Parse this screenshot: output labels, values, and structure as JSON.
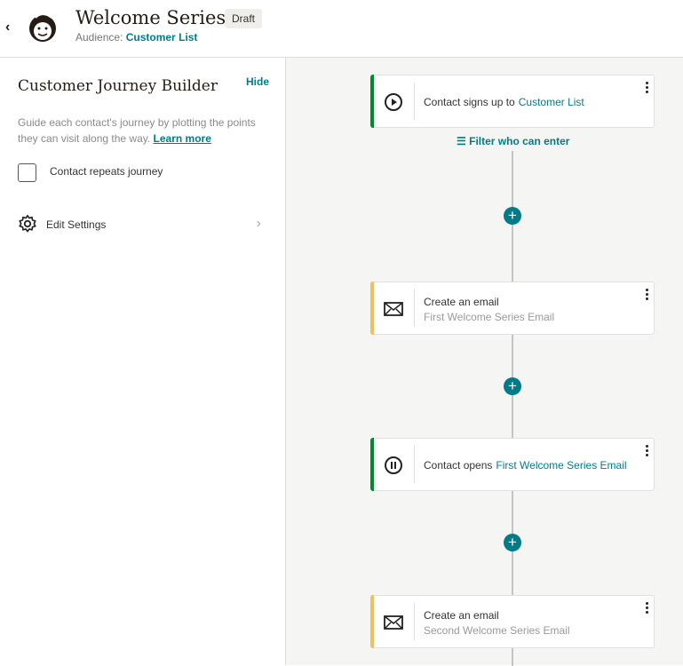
{
  "header": {
    "back": "‹",
    "title": "Welcome Series",
    "status": "Draft",
    "audience_label": "Audience:",
    "audience": "Customer List"
  },
  "sidebar": {
    "title": "Customer Journey Builder",
    "hide": "Hide",
    "description": "Guide each contact's journey by plotting the points they can visit along the way.",
    "learn_more": "Learn more",
    "repeat_label": "Contact repeats journey",
    "edit_settings": "Edit Settings"
  },
  "canvas": {
    "filter": "Filter who can enter",
    "cards": [
      {
        "text": "Contact signs up to",
        "link": "Customer List",
        "type": "trigger",
        "accent": "#00892e"
      },
      {
        "text": "Create an email",
        "sub": "First Welcome Series Email",
        "type": "email",
        "accent": "#f0c060"
      },
      {
        "text": "Contact opens",
        "link": "First Welcome Series Email",
        "type": "trigger",
        "accent": "#00892e"
      },
      {
        "text": "Create an email",
        "sub": "Second Welcome Series Email",
        "type": "email",
        "accent": "#f0c060"
      }
    ]
  }
}
